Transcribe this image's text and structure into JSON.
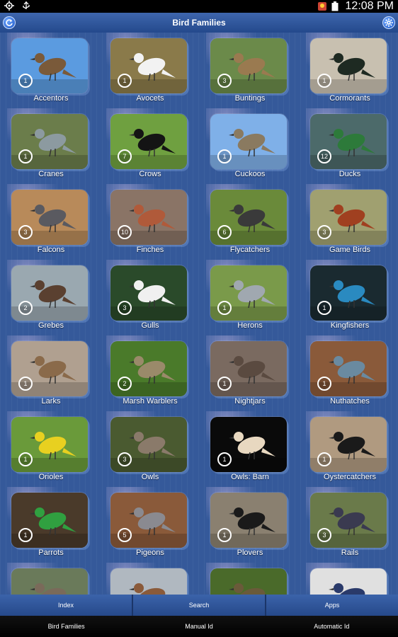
{
  "status_bar": {
    "time": "12:08 PM",
    "icons": [
      "location-icon",
      "usb-icon",
      "app-notification-icon",
      "battery-icon"
    ]
  },
  "header": {
    "title": "Bird Families",
    "left_icon": "refresh-icon",
    "right_icon": "settings-icon"
  },
  "families": [
    {
      "name": "Accentors",
      "count": "1",
      "bg": "#5b9be0",
      "fg": "#7a5a3a"
    },
    {
      "name": "Avocets",
      "count": "1",
      "bg": "#8a7a4a",
      "fg": "#f2f2f2"
    },
    {
      "name": "Buntings",
      "count": "3",
      "bg": "#6b8a4a",
      "fg": "#9a7a50"
    },
    {
      "name": "Cormorants",
      "count": "1",
      "bg": "#c8c0b0",
      "fg": "#1e2a22"
    },
    {
      "name": "Cranes",
      "count": "1",
      "bg": "#6b7d4b",
      "fg": "#8c9aa0"
    },
    {
      "name": "Crows",
      "count": "7",
      "bg": "#6fa040",
      "fg": "#141414"
    },
    {
      "name": "Cuckoos",
      "count": "1",
      "bg": "#7fb0e8",
      "fg": "#8a7a60"
    },
    {
      "name": "Ducks",
      "count": "12",
      "bg": "#4c6a6a",
      "fg": "#2d7a3a"
    },
    {
      "name": "Falcons",
      "count": "3",
      "bg": "#b88a5a",
      "fg": "#5a5a60"
    },
    {
      "name": "Finches",
      "count": "10",
      "bg": "#8a7466",
      "fg": "#b05a3a"
    },
    {
      "name": "Flycatchers",
      "count": "6",
      "bg": "#6a8a3a",
      "fg": "#3a3a3a"
    },
    {
      "name": "Game Birds",
      "count": "3",
      "bg": "#a0a070",
      "fg": "#a04020"
    },
    {
      "name": "Grebes",
      "count": "2",
      "bg": "#9aa8b0",
      "fg": "#5a4030"
    },
    {
      "name": "Gulls",
      "count": "3",
      "bg": "#2a4a2a",
      "fg": "#f0f0f0"
    },
    {
      "name": "Herons",
      "count": "1",
      "bg": "#7a9a4a",
      "fg": "#a0a8b0"
    },
    {
      "name": "Kingfishers",
      "count": "1",
      "bg": "#1a2a30",
      "fg": "#2a8ac0"
    },
    {
      "name": "Larks",
      "count": "1",
      "bg": "#b0a090",
      "fg": "#8a6a4a"
    },
    {
      "name": "Marsh Warblers",
      "count": "2",
      "bg": "#4a7a2a",
      "fg": "#9a8a6a"
    },
    {
      "name": "Nightjars",
      "count": "1",
      "bg": "#7a6a60",
      "fg": "#5a4a40"
    },
    {
      "name": "Nuthatches",
      "count": "1",
      "bg": "#8a5a3a",
      "fg": "#6a8aa0"
    },
    {
      "name": "Orioles",
      "count": "1",
      "bg": "#6a9a3a",
      "fg": "#e8d020"
    },
    {
      "name": "Owls",
      "count": "3",
      "bg": "#4a5a30",
      "fg": "#8a7a6a"
    },
    {
      "name": "Owls: Barn",
      "count": "1",
      "bg": "#0a0a0a",
      "fg": "#e8d8c0"
    },
    {
      "name": "Oystercatchers",
      "count": "1",
      "bg": "#b09a80",
      "fg": "#1a1a1a"
    },
    {
      "name": "Parrots",
      "count": "1",
      "bg": "#4a3a2a",
      "fg": "#30a040"
    },
    {
      "name": "Pigeons",
      "count": "5",
      "bg": "#8a5a3a",
      "fg": "#8a8a90"
    },
    {
      "name": "Plovers",
      "count": "1",
      "bg": "#8a8070",
      "fg": "#1a1a1a"
    },
    {
      "name": "Rails",
      "count": "3",
      "bg": "#6a7a4a",
      "fg": "#3a3a50"
    },
    {
      "name": "",
      "count": "",
      "bg": "#6a7a5a",
      "fg": "#7a6a5a"
    },
    {
      "name": "",
      "count": "",
      "bg": "#b0b8c0",
      "fg": "#8a5a3a"
    },
    {
      "name": "",
      "count": "",
      "bg": "#4a6a2a",
      "fg": "#6a5a3a"
    },
    {
      "name": "",
      "count": "",
      "bg": "#e0e0e0",
      "fg": "#2a3a6a"
    }
  ],
  "tabs_top": [
    "Index",
    "Search",
    "Apps"
  ],
  "tabs_bottom": [
    "Bird Families",
    "Manual Id",
    "Automatic Id"
  ]
}
